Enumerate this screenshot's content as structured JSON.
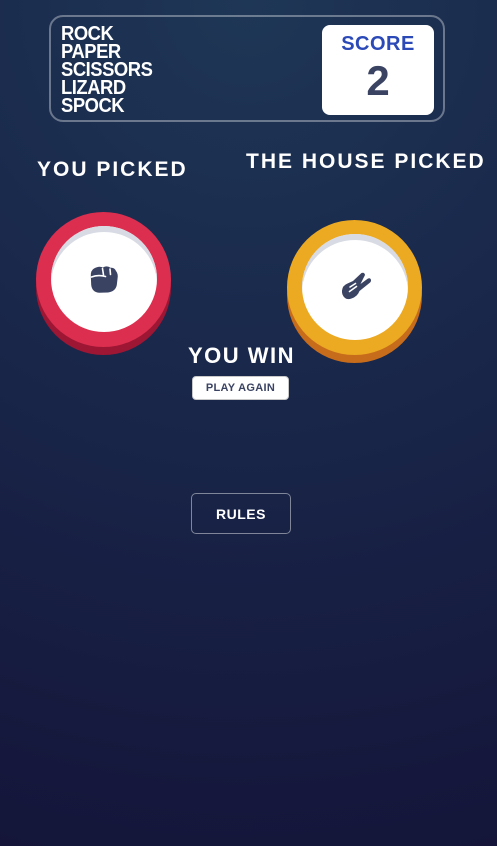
{
  "header": {
    "title_lines": [
      "ROCK",
      "PAPER",
      "SCISSORS",
      "LIZARD",
      "SPOCK"
    ],
    "score_label": "SCORE",
    "score_value": "2"
  },
  "game": {
    "player_label": "YOU PICKED",
    "house_label": "THE HOUSE PICKED",
    "player_choice": {
      "icon": "rock-icon",
      "ring_color": "#dc2e4e",
      "shadow_color": "#9d1634"
    },
    "house_choice": {
      "icon": "scissors-icon",
      "ring_color": "#eca922",
      "shadow_color": "#c76c1b"
    },
    "result_text": "YOU WIN",
    "play_again_label": "PLAY AGAIN"
  },
  "footer": {
    "rules_label": "RULES"
  },
  "colors": {
    "score_label": "#2b4ab8",
    "dark_text": "#3b4363",
    "background_top": "#1f3756",
    "background_bottom": "#141539"
  }
}
